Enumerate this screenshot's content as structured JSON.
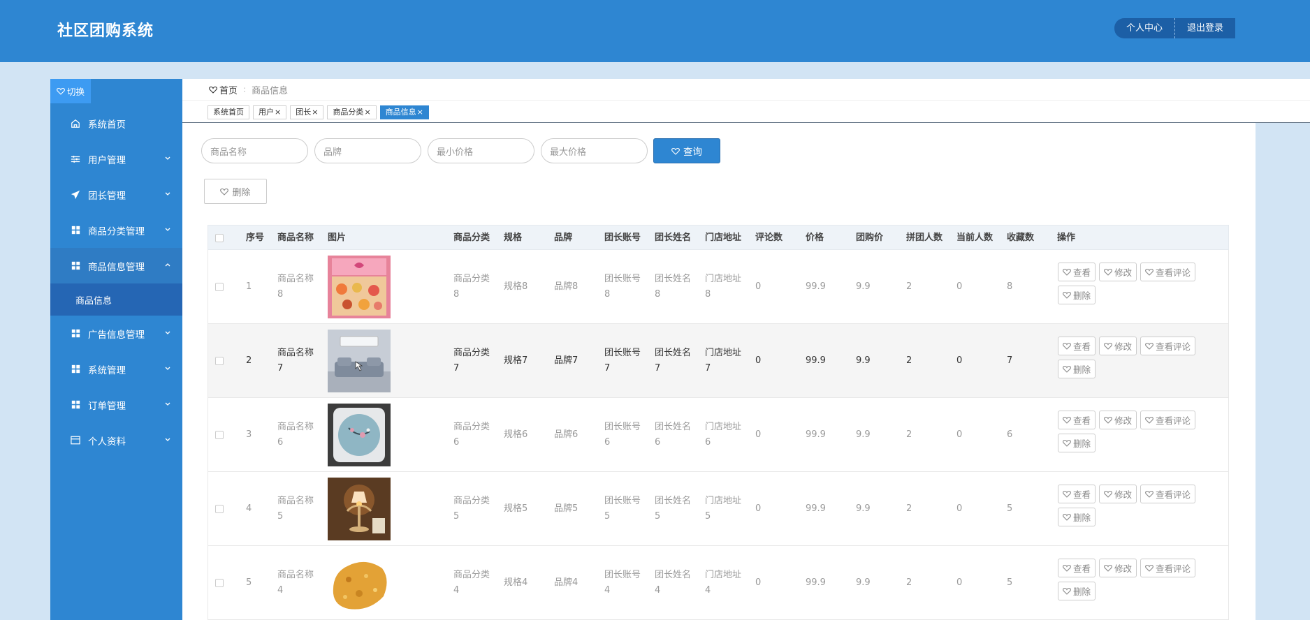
{
  "app": {
    "title": "社区团购系统"
  },
  "header": {
    "profile_label": "个人中心",
    "logout_label": "退出登录"
  },
  "sidebar": {
    "toggle_label": "切换",
    "items": [
      {
        "label": "系统首页",
        "icon": "home-icon"
      },
      {
        "label": "用户管理",
        "icon": "sliders-icon"
      },
      {
        "label": "团长管理",
        "icon": "paper-plane-icon"
      },
      {
        "label": "商品分类管理",
        "icon": "grid-icon"
      },
      {
        "label": "商品信息管理",
        "icon": "grid-icon"
      },
      {
        "label": "广告信息管理",
        "icon": "grid-icon"
      },
      {
        "label": "系统管理",
        "icon": "grid-icon"
      },
      {
        "label": "订单管理",
        "icon": "grid-icon"
      },
      {
        "label": "个人资料",
        "icon": "card-icon"
      }
    ],
    "submenu_label": "商品信息"
  },
  "breadcrumb": {
    "home": "首页",
    "separator": ":",
    "current": "商品信息"
  },
  "tabs": [
    {
      "label": "系统首页",
      "closable": false
    },
    {
      "label": "用户",
      "closable": true
    },
    {
      "label": "团长",
      "closable": true
    },
    {
      "label": "商品分类",
      "closable": true
    },
    {
      "label": "商品信息",
      "closable": true
    }
  ],
  "close_glyph": "×",
  "search": {
    "name_placeholder": "商品名称",
    "brand_placeholder": "品牌",
    "min_price_placeholder": "最小价格",
    "max_price_placeholder": "最大价格",
    "query_label": "查询"
  },
  "delete_label": "删除",
  "table": {
    "headers": [
      "序号",
      "商品名称",
      "图片",
      "商品分类",
      "规格",
      "品牌",
      "团长账号",
      "团长姓名",
      "门店地址",
      "评论数",
      "价格",
      "团购价",
      "拼团人数",
      "当前人数",
      "收藏数",
      "操作"
    ],
    "ops": {
      "view": "查看",
      "edit": "修改",
      "comments": "查看评论",
      "delete": "删除"
    },
    "rows": [
      {
        "index": "1",
        "name": "商品名称8",
        "image": "gift-box",
        "category": "商品分类8",
        "spec": "规格8",
        "brand": "品牌8",
        "leader_account": "团长账号8",
        "leader_name": "团长姓名8",
        "address": "门店地址8",
        "comments": "0",
        "price": "99.9",
        "group_price": "9.9",
        "group_size": "2",
        "current": "0",
        "favorites": "8"
      },
      {
        "index": "2",
        "name": "商品名称7",
        "image": "air-conditioner",
        "category": "商品分类7",
        "spec": "规格7",
        "brand": "品牌7",
        "leader_account": "团长账号7",
        "leader_name": "团长姓名7",
        "address": "门店地址7",
        "comments": "0",
        "price": "99.9",
        "group_price": "9.9",
        "group_size": "2",
        "current": "0",
        "favorites": "7"
      },
      {
        "index": "3",
        "name": "商品名称6",
        "image": "pillow",
        "category": "商品分类6",
        "spec": "规格6",
        "brand": "品牌6",
        "leader_account": "团长账号6",
        "leader_name": "团长姓名6",
        "address": "门店地址6",
        "comments": "0",
        "price": "99.9",
        "group_price": "9.9",
        "group_size": "2",
        "current": "0",
        "favorites": "6"
      },
      {
        "index": "4",
        "name": "商品名称5",
        "image": "lamp",
        "category": "商品分类5",
        "spec": "规格5",
        "brand": "品牌5",
        "leader_account": "团长账号5",
        "leader_name": "团长姓名5",
        "address": "门店地址5",
        "comments": "0",
        "price": "99.9",
        "group_price": "9.9",
        "group_size": "2",
        "current": "0",
        "favorites": "5"
      },
      {
        "index": "5",
        "name": "商品名称4",
        "image": "fried-food",
        "category": "商品分类4",
        "spec": "规格4",
        "brand": "品牌4",
        "leader_account": "团长账号4",
        "leader_name": "团长姓名4",
        "address": "门店地址4",
        "comments": "0",
        "price": "99.9",
        "group_price": "9.9",
        "group_size": "2",
        "current": "0",
        "favorites": "5"
      }
    ]
  },
  "colors": {
    "primary": "#2e86d2",
    "sidebar_active": "#2566b4",
    "background": "#d2e4f4"
  }
}
